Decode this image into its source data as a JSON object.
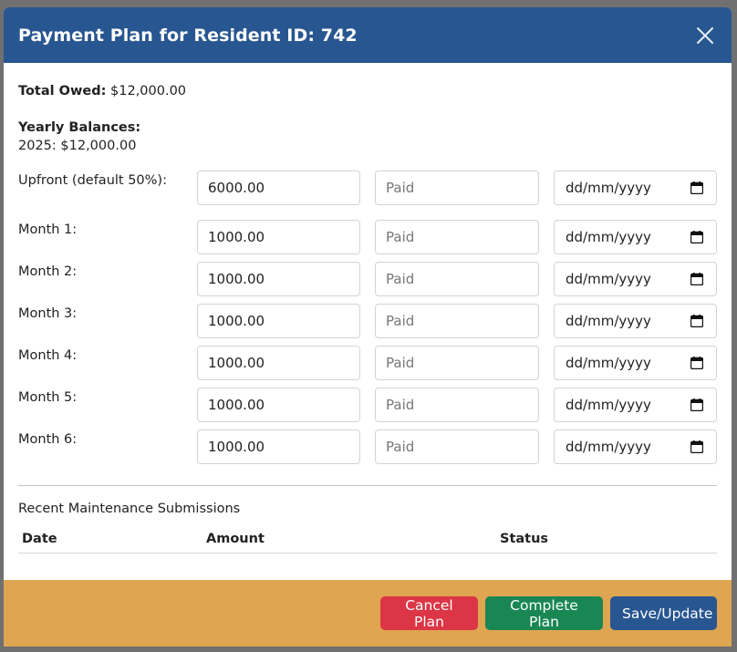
{
  "modal": {
    "title": "Payment Plan for Resident ID: 742",
    "close_icon": "close-icon"
  },
  "summary": {
    "total_label": "Total Owed:",
    "total_value": "$12,000.00",
    "yearly_title": "Yearly Balances:",
    "yearly_items": [
      "2025: $12,000.00"
    ]
  },
  "payments": [
    {
      "label": "Upfront (default 50%):",
      "amount": "6000.00",
      "paid_placeholder": "Paid",
      "date_placeholder": "dd/mm/yyyy"
    },
    {
      "label": "Month 1:",
      "amount": "1000.00",
      "paid_placeholder": "Paid",
      "date_placeholder": "dd/mm/yyyy"
    },
    {
      "label": "Month 2:",
      "amount": "1000.00",
      "paid_placeholder": "Paid",
      "date_placeholder": "dd/mm/yyyy"
    },
    {
      "label": "Month 3:",
      "amount": "1000.00",
      "paid_placeholder": "Paid",
      "date_placeholder": "dd/mm/yyyy"
    },
    {
      "label": "Month 4:",
      "amount": "1000.00",
      "paid_placeholder": "Paid",
      "date_placeholder": "dd/mm/yyyy"
    },
    {
      "label": "Month 5:",
      "amount": "1000.00",
      "paid_placeholder": "Paid",
      "date_placeholder": "dd/mm/yyyy"
    },
    {
      "label": "Month 6:",
      "amount": "1000.00",
      "paid_placeholder": "Paid",
      "date_placeholder": "dd/mm/yyyy"
    }
  ],
  "maintenance": {
    "title": "Recent Maintenance Submissions",
    "columns": [
      "Date",
      "Amount",
      "Status"
    ]
  },
  "footer": {
    "cancel_label": "Cancel Plan",
    "complete_label": "Complete Plan",
    "save_label": "Save/Update"
  },
  "colors": {
    "header": "#285690",
    "footer": "#dfa550",
    "cancel": "#dc3545",
    "complete": "#198754",
    "save": "#285690"
  }
}
